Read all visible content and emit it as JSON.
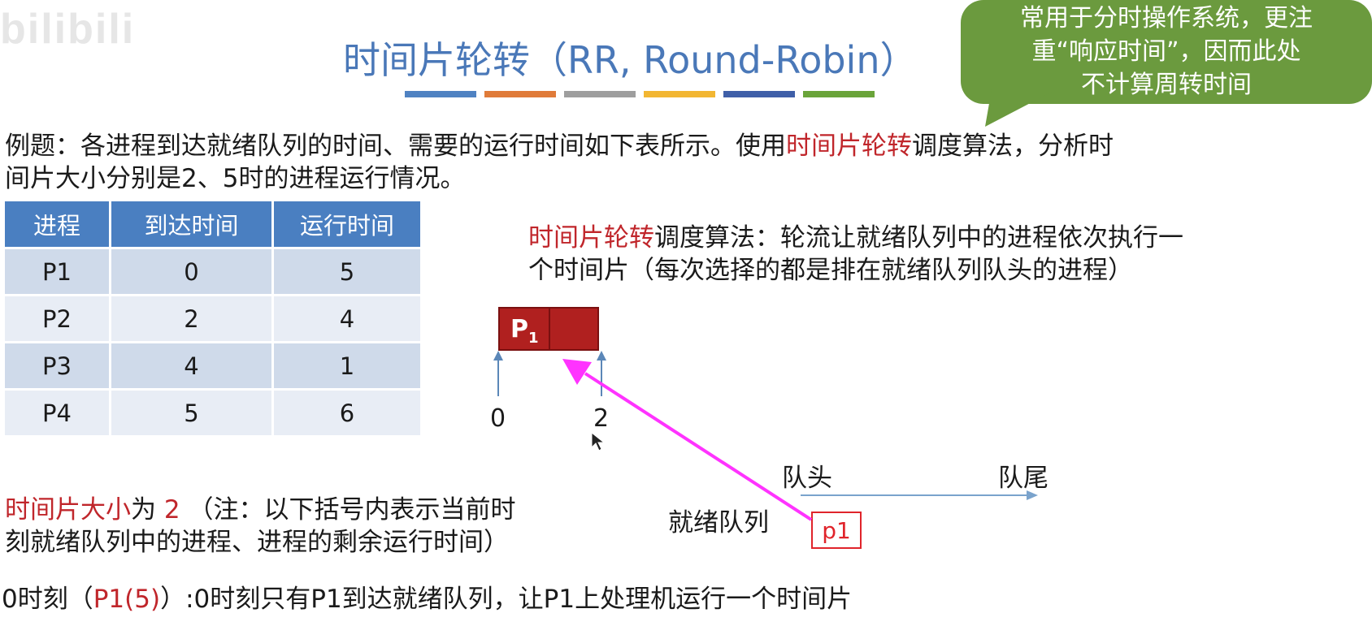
{
  "watermark": "bilibili",
  "title": "时间片轮转（RR, Round-Robin）",
  "title_bar_colors": [
    "#4f82c2",
    "#e07b39",
    "#9e9e9e",
    "#f2b632",
    "#3f5fa8",
    "#6aa43a"
  ],
  "callout": {
    "line1": "常用于分时操作系统，更注",
    "line2": "重“响应时间”，因而此处",
    "line3": "不计算周转时间"
  },
  "example": {
    "prefix": "例题：各进程到达就绪队列的时间、需要的运行时间如下表所示。使用",
    "highlight": "时间片轮转",
    "suffix": "调度算法，分析时",
    "line2": "间片大小分别是2、5时的进程运行情况。"
  },
  "table": {
    "headers": [
      "进程",
      "到达时间",
      "运行时间"
    ],
    "rows": [
      [
        "P1",
        "0",
        "5"
      ],
      [
        "P2",
        "2",
        "4"
      ],
      [
        "P3",
        "4",
        "1"
      ],
      [
        "P4",
        "5",
        "6"
      ]
    ]
  },
  "rr_desc": {
    "highlight": "时间片轮转",
    "rest": "调度算法：轮流让就绪队列中的进程依次执行一",
    "line2": "个时间片（每次选择的都是排在就绪队列队头的进程）"
  },
  "gantt": {
    "block_label": "P",
    "block_sub": "1",
    "tick_start": "0",
    "tick_end": "2"
  },
  "queue": {
    "head_label": "队头",
    "tail_label": "队尾",
    "name": "就绪队列",
    "item": "p1"
  },
  "slice_note": {
    "highlight": "时间片大小",
    "mid": "为",
    "value": "2",
    "rest": "（注：以下括号内表示当前时",
    "line2": "刻就绪队列中的进程、进程的剩余运行时间）"
  },
  "time0": {
    "prefix": "0时刻（",
    "highlight": "P1(5)",
    "suffix": "）:0时刻只有P1到达就绪队列，让P1上处理机运行一个时间片"
  },
  "colors": {
    "title": "#4a78b8",
    "callout": "#6b9a3e",
    "highlight": "#c0262b",
    "table_header": "#4a7fc1",
    "gantt_block": "#b0201f",
    "annotation_arrow": "#ff33ff"
  }
}
